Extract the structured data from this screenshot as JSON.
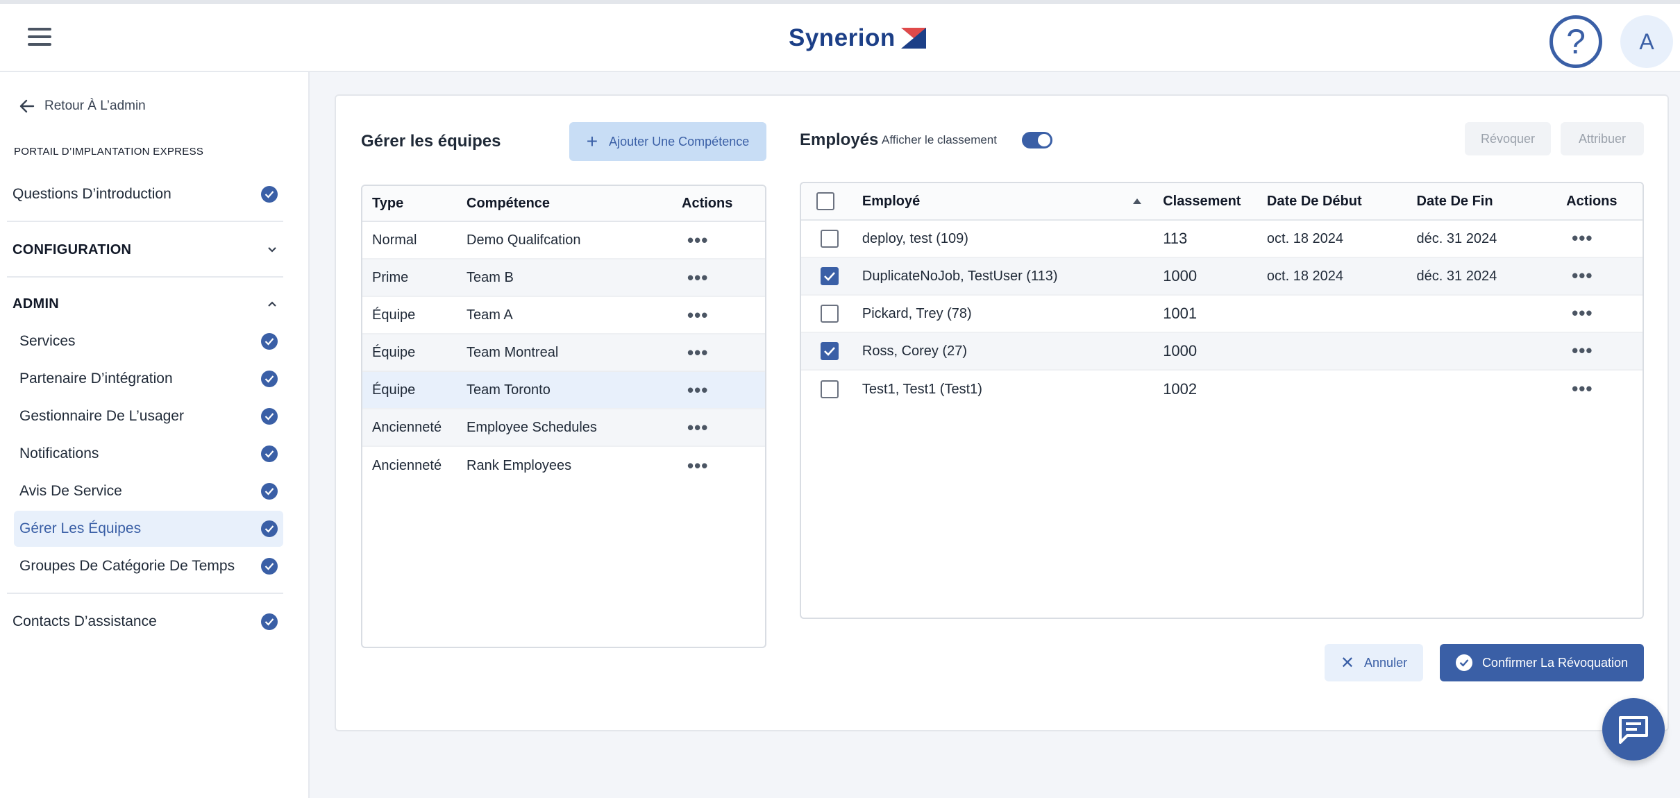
{
  "header": {
    "logo_text": "Synerion",
    "help_glyph": "?",
    "avatar_initial": "A",
    "icons": {
      "menu": "hamburger-icon",
      "help": "question-mark-icon"
    }
  },
  "sidebar": {
    "back_label": "Retour À L’admin",
    "portal_title": "PORTAIL D’IMPLANTATION EXPRESS",
    "intro_label": "Questions D’introduction",
    "config_label": "CONFIGURATION",
    "admin_label": "ADMIN",
    "admin_items": [
      {
        "label": "Services"
      },
      {
        "label": "Partenaire D’intégration"
      },
      {
        "label": "Gestionnaire De L’usager"
      },
      {
        "label": "Notifications"
      },
      {
        "label": "Avis De Service"
      },
      {
        "label": "Gérer Les Équipes",
        "active": true
      },
      {
        "label": "Groupes De Catégorie De Temps"
      }
    ],
    "contacts_label": "Contacts D’assistance",
    "accent_color": "#3a5fa6"
  },
  "teams": {
    "title": "Gérer les équipes",
    "add_button": "Ajouter Une Compétence",
    "columns": {
      "type": "Type",
      "skill": "Compétence",
      "actions": "Actions"
    },
    "rows": [
      {
        "type": "Normal",
        "skill": "Demo Qualifcation"
      },
      {
        "type": "Prime",
        "skill": "Team B"
      },
      {
        "type": "Équipe",
        "skill": "Team A"
      },
      {
        "type": "Équipe",
        "skill": "Team Montreal"
      },
      {
        "type": "Équipe",
        "skill": "Team Toronto"
      },
      {
        "type": "Ancienneté",
        "skill": "Employee Schedules"
      },
      {
        "type": "Ancienneté",
        "skill": "Rank Employees"
      }
    ],
    "actions_glyph": "•••"
  },
  "employees": {
    "title": "Employés",
    "show_rank_label": "Afficher le classement",
    "show_rank_on": true,
    "revoke_label": "Révoquer",
    "assign_label": "Attribuer",
    "columns": {
      "employee": "Employé",
      "rank": "Classement",
      "start": "Date De Début",
      "end": "Date De Fin",
      "actions": "Actions"
    },
    "rows": [
      {
        "name": "deploy, test (109)",
        "rank": "113",
        "start": "oct. 18 2024",
        "end": "déc. 31 2024",
        "checked": false
      },
      {
        "name": "DuplicateNoJob, TestUser (113)",
        "rank": "1000",
        "start": "oct. 18 2024",
        "end": "déc. 31 2024",
        "checked": true
      },
      {
        "name": "Pickard, Trey (78)",
        "rank": "1001",
        "start": "",
        "end": "",
        "checked": false
      },
      {
        "name": "Ross, Corey (27)",
        "rank": "1000",
        "start": "",
        "end": "",
        "checked": true
      },
      {
        "name": "Test1, Test1 (Test1)",
        "rank": "1002",
        "start": "",
        "end": "",
        "checked": false
      }
    ],
    "actions_glyph": "•••",
    "cancel_label": "Annuler",
    "confirm_label": "Confirmer La Révoquation"
  }
}
